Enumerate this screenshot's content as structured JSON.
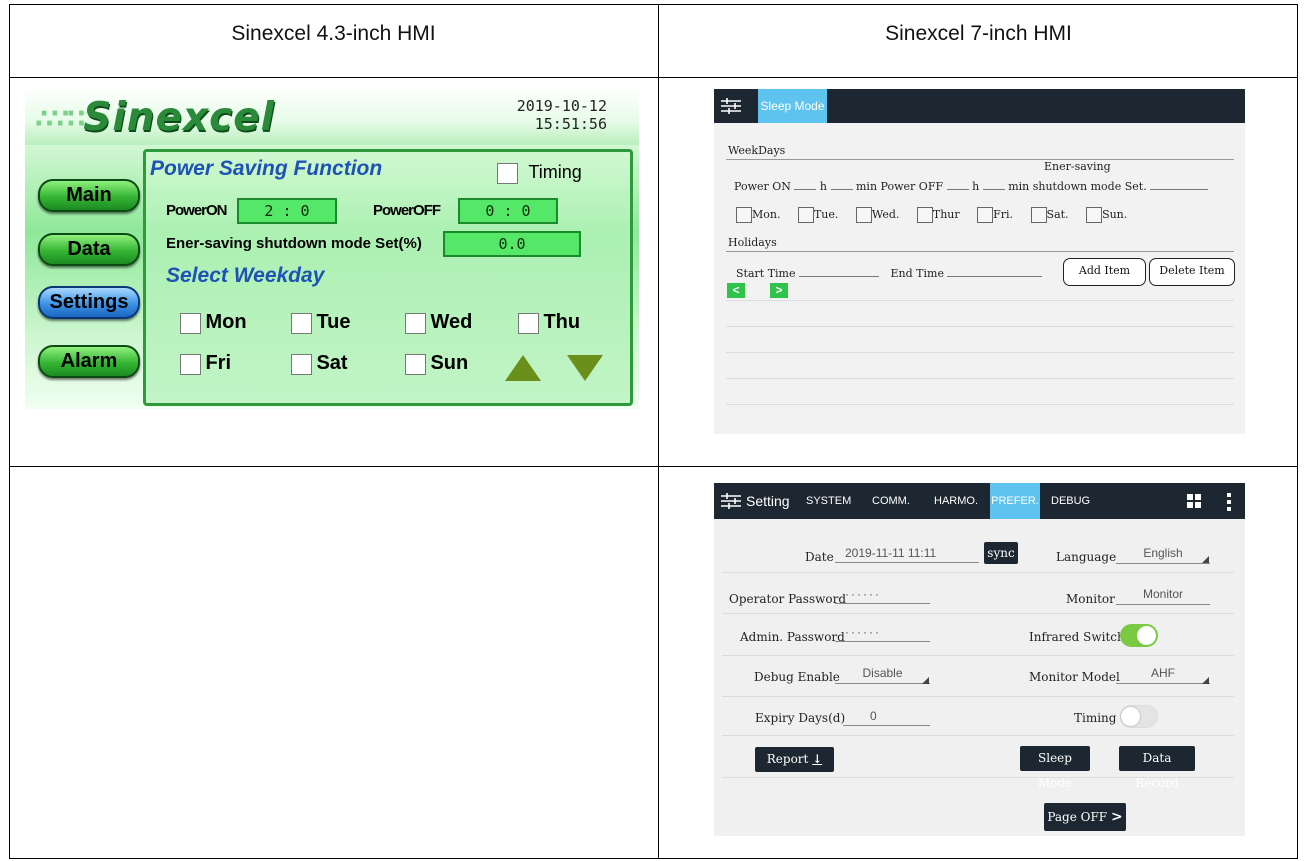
{
  "table": {
    "col1_header": "Sinexcel 4.3-inch HMI",
    "col2_header": "Sinexcel 7-inch HMI"
  },
  "hmi43": {
    "logo": "Sinexcel",
    "date": "2019-10-12",
    "time": "15:51:56",
    "nav": [
      "Main",
      "Data",
      "Settings",
      "Alarm"
    ],
    "selected_nav": "Settings",
    "section_title": "Power Saving Function",
    "timing_label": "Timing",
    "power_on_label": "PowerON",
    "power_on_value": "2 : 0",
    "power_off_label": "PowerOFF",
    "power_off_value": "0 : 0",
    "shutdown_label": "Ener-saving shutdown mode Set(%)",
    "shutdown_value": "0.0",
    "weekday_title": "Select Weekday",
    "days": [
      "Mon",
      "Tue",
      "Wed",
      "Thu",
      "Fri",
      "Sat",
      "Sun"
    ]
  },
  "sleep7": {
    "tab": "Sleep Mode",
    "weekdays_label": "WeekDays",
    "power_on": "Power ON",
    "h": "h",
    "min": "min",
    "power_off": "Power OFF",
    "ener_saving": "Ener-saving",
    "shutdown_set": "shutdown mode Set.",
    "days": [
      "Mon.",
      "Tue.",
      "Wed.",
      "Thur",
      "Fri.",
      "Sat.",
      "Sun."
    ],
    "holidays_label": "Holidays",
    "start_time": "Start Time",
    "end_time": "End Time",
    "dash": "-",
    "add_item": "Add Item",
    "delete_item": "Delete Item",
    "prev": "<",
    "next": ">"
  },
  "setting7": {
    "title": "Setting",
    "tabs": [
      "SYSTEM",
      "COMM.",
      "HARMO.",
      "PREFER.",
      "DEBUG"
    ],
    "active_tab": "PREFER.",
    "date_label": "Date",
    "date_value": "2019-11-11 11:11",
    "sync": "sync",
    "language_label": "Language",
    "language_value": "English",
    "operator_pw_label": "Operator Password",
    "operator_pw_value": "······",
    "monitor_label": "Monitor",
    "monitor_value": "Monitor",
    "admin_pw_label": "Admin. Password",
    "admin_pw_value": "······",
    "infrared_label": "Infrared Switch",
    "infrared_on": true,
    "debug_label": "Debug Enable",
    "debug_value": "Disable",
    "monitor_model_label": "Monitor Model",
    "monitor_model_value": "AHF",
    "expiry_label": "Expiry Days(d)",
    "expiry_value": "0",
    "timing_label": "Timing",
    "timing_on": false,
    "report": "Report",
    "sleep_mode": "Sleep Mode",
    "data_record": "Data Record",
    "page_off": "Page OFF"
  },
  "colors": {
    "hmi_green": "#35b534",
    "hmi_selected_blue": "#3c93e6",
    "title_blue": "#1e52b5",
    "dark_bar": "#1c2731",
    "tab_active": "#5ec3ee",
    "toggle_green": "#7ac943",
    "nav_green_button": "#2ec34a"
  }
}
